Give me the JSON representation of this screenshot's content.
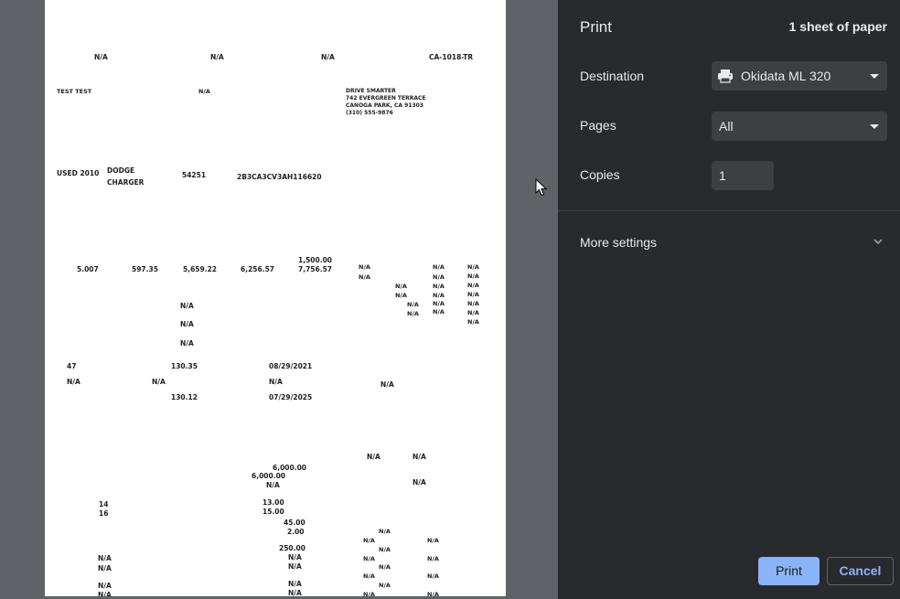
{
  "panel": {
    "title": "Print",
    "sheet_count": "1 sheet of paper",
    "destination_label": "Destination",
    "destination_value": "Okidata ML 320",
    "pages_label": "Pages",
    "pages_value": "All",
    "copies_label": "Copies",
    "copies_value": "1",
    "more_settings_label": "More settings",
    "print_button": "Print",
    "cancel_button": "Cancel"
  },
  "preview": {
    "header": {
      "na1": "N/A",
      "na2": "N/A",
      "na3": "N/A",
      "form_id": "CA-1018-TR"
    },
    "customer": "TEST  TEST",
    "customer_na": "N/A",
    "dealer": {
      "line1": "DRIVE SMARTER",
      "line2": "742 EVERGREEN TERRACE",
      "line3": "CANOGA PARK, CA 91303",
      "line4": "(310) 555-9876"
    },
    "vehicle": {
      "condition_year": "USED 2010",
      "make": "DODGE",
      "model": "CHARGER",
      "odometer": "54251",
      "vin": "2B3CA3CV3AH116620"
    },
    "financial": {
      "apr": "5.007",
      "finance_charge": "597.35",
      "amount_financed": "5,659.22",
      "total_payments": "6,256.57",
      "down_payment": "1,500.00",
      "total_sale_price": "7,756.57",
      "na": "N/A"
    },
    "payments": {
      "count": "47",
      "amount": "130.35",
      "first_date": "08/29/2021",
      "final_amount": "130.12",
      "final_date": "07/29/2025",
      "na": "N/A"
    },
    "itemization": {
      "cash_price_a": "6,000.00",
      "cash_price_b": "6,000.00",
      "fee_a": "13.00",
      "fee_b": "15.00",
      "fee_c": "45.00",
      "fee_d": "2.00",
      "fee_e": "250.00",
      "num_a": "14",
      "num_b": "16",
      "na": "N/A"
    }
  }
}
